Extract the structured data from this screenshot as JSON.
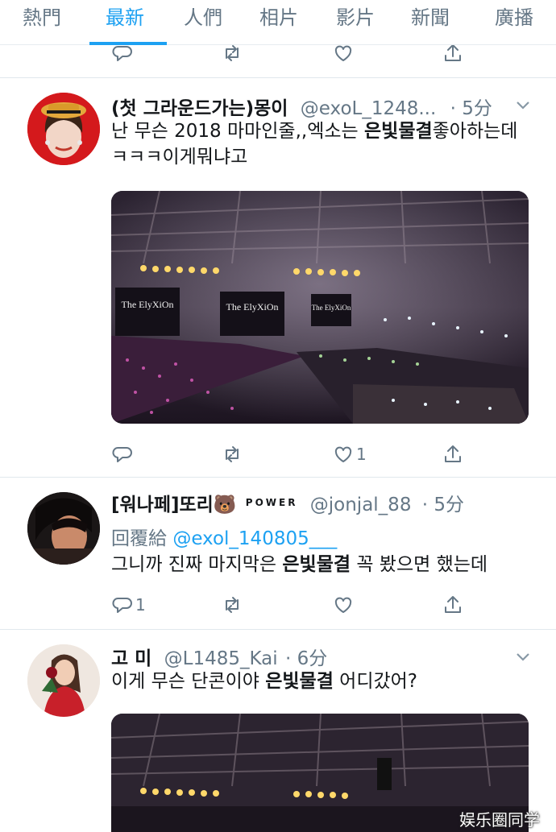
{
  "tabs": [
    {
      "label": "熱門"
    },
    {
      "label": "最新",
      "active": true
    },
    {
      "label": "人們"
    },
    {
      "label": "相片"
    },
    {
      "label": "影片"
    },
    {
      "label": "新聞"
    },
    {
      "label": "廣播"
    }
  ],
  "tweets": [
    {
      "name": "(첫 그라운드가는)몽이",
      "handle": "@exoL_1248...",
      "time": "· 5分",
      "text_pre": "난 무슨 2018 마마인줄,,엑소는 ",
      "text_bold": "은빛물결",
      "text_post": "좋아하는데 ㅋㅋㅋ이게뭐냐고",
      "media_texts": [
        "The ElyXiOn",
        "The ElyXiOn",
        "The ElyXiOn"
      ],
      "actions": {
        "reply": "",
        "retweet": "",
        "like": "1"
      }
    },
    {
      "name": "[워나페]또리🐻",
      "name_sup": "POWER",
      "handle": "@jonjal_88",
      "time": "· 5分",
      "reply_label": "回覆給",
      "reply_handle": "@exol_140805___",
      "text_pre": "그니까 진짜 마지막은 ",
      "text_bold": "은빛물결",
      "text_post": " 꼭 봤으면 했는데",
      "actions": {
        "reply": "1",
        "retweet": "",
        "like": ""
      }
    },
    {
      "name": "고 미",
      "handle": "@L1485_Kai",
      "time": "· 6分",
      "text_pre": "이게 무슨 단콘이야 ",
      "text_bold": "은빛물결",
      "text_post": " 어디갔어?"
    }
  ],
  "watermark": "娱乐圈同学",
  "icons": {
    "reply": "reply-icon",
    "retweet": "retweet-icon",
    "like": "heart-icon",
    "share": "share-icon",
    "chevron": "chevron-down-icon"
  },
  "colors": {
    "accent": "#1da1f2",
    "secondary": "#657786"
  }
}
